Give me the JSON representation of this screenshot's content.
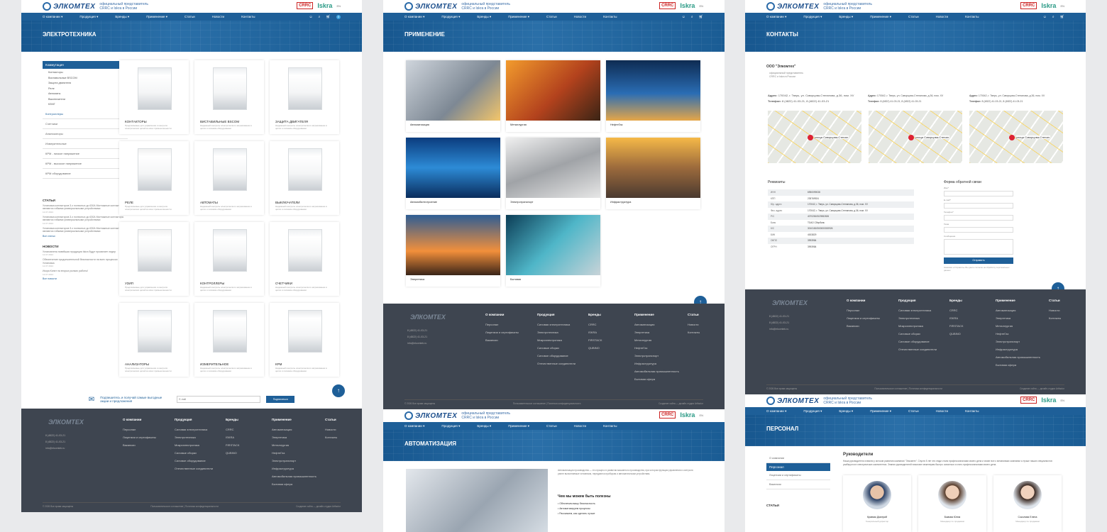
{
  "header": {
    "logo": "ЭЛКОМТЕХ",
    "logo_sub": "ГРУППА КЛЕ",
    "tagline1": "официальный представитель",
    "tagline2": "CRRC и Iskra в России",
    "crrc": "CRRC",
    "iskra": "Iskra",
    "lang": "EN"
  },
  "nav": [
    "О компании ▾",
    "Продукция ▾",
    "Бренды ▾",
    "Применение ▾",
    "Статьи",
    "Новости",
    "Контакты"
  ],
  "panel1": {
    "title": "ЭЛЕКТРОТЕХНИКА",
    "sidebar_active": "Коммутация",
    "sidebar_sub": [
      "Контакторы",
      "Виставильные BSCOM",
      "Защита двигателя",
      "Реле",
      "Автоматы",
      "Выключатели",
      "КЗМГ"
    ],
    "sidebar_items": [
      "Контроллеры",
      "Счетчики",
      "Анализаторы",
      "Измерительные",
      "КРМ - низкое напряжение",
      "КРМ - высокое напряжение",
      "КРМ оборудование"
    ],
    "articles_title": "СТАТЬИ",
    "news_title": "НОВОСТИ",
    "article1": "Установка контакторов 3-х полюсных до 630А Монтажные контакторы являются гибкими универсальными устройствами",
    "article2": "Установка контакторов 3-х полюсных до 630А Монтажные контакторы являются гибкими универсальными устройствами",
    "article3": "Установка контакторов 3-х полюсных до 630А Монтажные контакторы являются гибкими универсальными устройствами",
    "news1": "Установлена новейшая продукция Iskra будут проявляет лидер",
    "news2": "Обеспечение продолжительной безопасности на всех процессах Установка",
    "news3": "Искра Копит на вторых рынках работы!",
    "date": "12.07.2024",
    "all_link": "Все статьи",
    "all_news": "Все новости",
    "products": [
      {
        "title": "КОНТАКТОРЫ",
        "desc": "Предлагаемые для управления и контроля электрических цепей во всех промышленности"
      },
      {
        "title": "ВИСТАВИЛЬНЫЕ BSCOM",
        "desc": "Надежный контроль электрического затрахование в цепях и силовом оборудовании"
      },
      {
        "title": "ЗАЩИТА ДВИГАТЕЛЯ",
        "desc": "Надежный контроль электрического затрахование в цепях и силовом оборудовании"
      },
      {
        "title": "РЕЛЕ",
        "desc": "Предлагаемые для управления и контроля электрических цепей во всех промышленности"
      },
      {
        "title": "АВТОМАТЫ",
        "desc": "Надежный контроль электрического затрахование в цепях и силовом оборудовании"
      },
      {
        "title": "ВЫКЛЮЧАТЕЛИ",
        "desc": "Надежный контроль электрического затрахование в цепях и силовом оборудовании"
      },
      {
        "title": "УЗИП",
        "desc": "Предлагаемые для управления и контроля электрических цепей во всех промышленности"
      },
      {
        "title": "КОНТРОЛЛЕРЫ",
        "desc": "Надежный контроль электрического затрахование в цепях и силовом оборудовании"
      },
      {
        "title": "СЧЕТЧИКИ",
        "desc": "Надежный контроль электрического затрахование в цепях и силовом оборудовании"
      },
      {
        "title": "АНАЛИЗАТОРЫ",
        "desc": "Предлагаемые для управления и контроля электрических цепей во всех промышленности"
      },
      {
        "title": "ИЗМЕРИТЕЛЬНОЕ",
        "desc": "Надежный контроль электрического затрахование в цепях и силовом оборудовании"
      },
      {
        "title": "КРМ",
        "desc": "Надежный контроль электрического затрахование в цепях и силовом оборудовании"
      }
    ],
    "subscribe_text": "Подпишитесь и получай самые выгодные акции и предложения",
    "subscribe_placeholder": "E-mail",
    "subscribe_btn": "Подписаться"
  },
  "footer": {
    "phone1": "8 (4822) 41-03-21",
    "phone2": "8 (4822) 41-03-21",
    "email": "info@elcomtek.ru",
    "cols": [
      {
        "h": "О компании",
        "items": [
          "Персонал",
          "Лицензии и сертификаты",
          "Вакансии"
        ]
      },
      {
        "h": "Продукция",
        "items": [
          "Силовая электротехника",
          "Электротехника",
          "Микроэлектроника",
          "Силовые сборки",
          "Силовое оборудование",
          "Отечественные соединители"
        ]
      },
      {
        "h": "Бренды",
        "items": [
          "CRRC",
          "ISKRA",
          "FIRSTACK",
          "QUBINO"
        ]
      },
      {
        "h": "Применение",
        "items": [
          "Автоматизация",
          "Энергетика",
          "Металлургия",
          "НефтеГаз",
          "Электротранспорт",
          "Инфраструктура",
          "Автомобильная промышленность",
          "Бытовая сфера"
        ]
      },
      {
        "h": "Статьи",
        "items": [
          "Новости",
          "Контакты"
        ]
      }
    ],
    "copyright": "© 2026 Все права защищены",
    "policy": "Пользовательское соглашение | Политика конфиденциальности",
    "made": "Создание сайта — дизайн-студия Artfactor"
  },
  "panel2": {
    "title": "ПРИМЕНЕНИЕ",
    "apps": [
      "Автоматизация",
      "Металлургия",
      "НефтеГаз",
      "Автомобилестроение",
      "Электротранспорт",
      "Инфраструктура",
      "Энергетика",
      "Бытовая"
    ],
    "title2": "АВТОМАТИЗАЦИЯ",
    "intro": "Автоматизация производства — это процесс в развитии машинного производства, при котором функции управления и контроля ранее выполняемые человеком, передаются приборам и автоматическим устройствам.",
    "useful_title": "Чем мы можем быть полезны",
    "useful": [
      "Обеспечим вашу безопасность",
      "Автоматизируем процессы",
      "Расскажем, как сделать лучше"
    ]
  },
  "panel3": {
    "title": "КОНТАКТЫ",
    "company": "ООО \"Элкомтех\"",
    "company_desc1": "официальный представитель",
    "company_desc2": "CRRC и Iskra в России",
    "addr_label": "Адрес:",
    "addr": "170042, г. Тверь, ул. Скворцова-Степанова, д.36, пом. XV",
    "phone_label": "Телефон:",
    "phone": "8 (4822) 41-03-21, 8 (4822) 41-03-21",
    "map_label": "улица Скворцова-Степан.",
    "req_title": "Реквизиты",
    "req": [
      [
        "ИНН",
        "6950099038"
      ],
      [
        "КПП",
        "235769924"
      ],
      [
        "Юр. адрес",
        "170042, г. Тверь, ул. Скворцова-Степанова, д.36, пом. XV"
      ],
      [
        "Физ. адрес",
        "170042, г. Тверь, ул. Скворцова-Степанова, д.36, пом. XV"
      ],
      [
        "Р/С",
        "40702810523982826"
      ],
      [
        "Банк",
        "ТОАО Сбербанк"
      ],
      [
        "К/С",
        "30101810500000000926"
      ],
      [
        "БИК",
        "4003829"
      ],
      [
        "ОКПО",
        "3993984"
      ],
      [
        "ОГРН",
        "3993984"
      ]
    ],
    "form_title": "Форма обратной связи",
    "form_fields": [
      "Имя*",
      "E-mail*",
      "Телефон*",
      "Тема",
      "Сообщение"
    ],
    "form_btn": "Отправить",
    "form_note": "Нажимая «Отправить» Вы даете согласие на обработку персональных данных",
    "title2": "ПЕРСОНАЛ",
    "side": [
      "О компании",
      "Персонал",
      "Лицензии и сертификаты",
      "Вакансии"
    ],
    "leaders_title": "Руководители",
    "leaders_text": "Наша руководители ставили у истоков развития компании \"Элкомтех\". Спустя 5 лет эти люди стали профессионалами своего дела и знают все о механизмах компании и лучше наших специалистов разберутся в электрических компонентах. Знания руководителей помогают инженерам быстро освоиться и стать профессионалами своего дела.",
    "articles": "СТАТЬИ",
    "people": [
      {
        "name": "Кравчик Дмитрий",
        "role": "Генеральный директор"
      },
      {
        "name": "Бывова Юлия",
        "role": "Менеджер по продажам"
      },
      {
        "name": "Соколова Елена",
        "role": "Менеджер по продажам"
      }
    ]
  }
}
